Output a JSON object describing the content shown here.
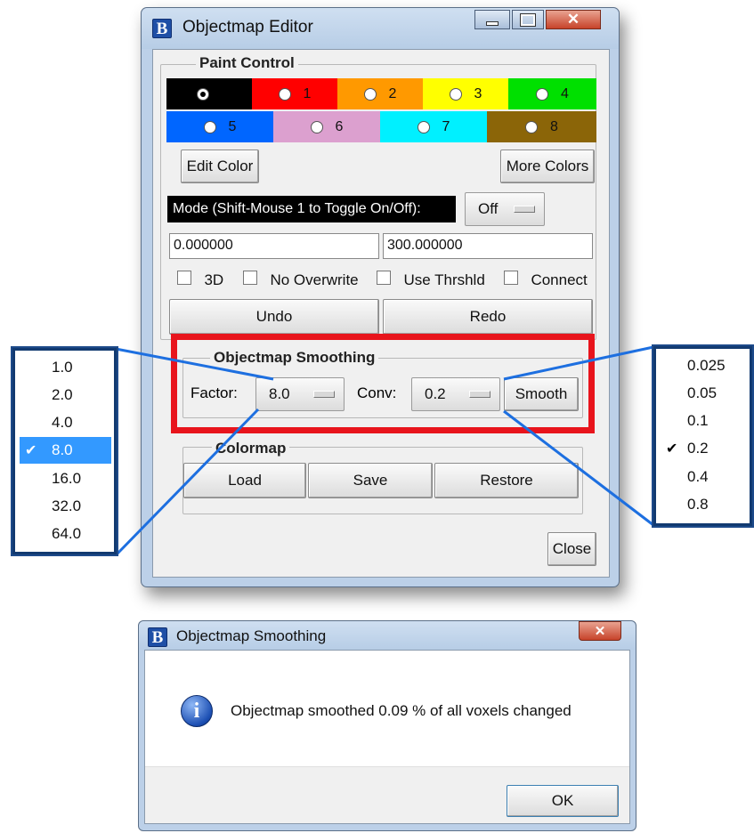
{
  "main_window": {
    "app_icon_letter": "B",
    "title": "Objectmap Editor",
    "paint_control": {
      "title": "Paint Control",
      "colors": [
        {
          "label": "",
          "color": "#000000",
          "selected": true
        },
        {
          "label": "1",
          "color": "#ff0000",
          "selected": false
        },
        {
          "label": "2",
          "color": "#ff9900",
          "selected": false
        },
        {
          "label": "3",
          "color": "#ffff00",
          "selected": false
        },
        {
          "label": "4",
          "color": "#00e000",
          "selected": false
        },
        {
          "label": "5",
          "color": "#0066ff",
          "selected": false
        },
        {
          "label": "6",
          "color": "#dca0cf",
          "selected": false
        },
        {
          "label": "7",
          "color": "#00f0ff",
          "selected": false
        },
        {
          "label": "8",
          "color": "#8b6508",
          "selected": false
        }
      ],
      "edit_color_label": "Edit Color",
      "more_colors_label": "More Colors",
      "mode_label": "Mode (Shift-Mouse 1 to Toggle On/Off):",
      "mode_value": "Off",
      "low_value": "0.000000",
      "high_value": "300.000000",
      "options": [
        {
          "label": "3D",
          "checked": false
        },
        {
          "label": "No Overwrite",
          "checked": false
        },
        {
          "label": "Use Thrshld",
          "checked": false
        },
        {
          "label": "Connect",
          "checked": false
        }
      ],
      "undo_label": "Undo",
      "redo_label": "Redo"
    },
    "smoothing": {
      "title": "Objectmap Smoothing",
      "factor_label": "Factor:",
      "factor_value": "8.0",
      "conv_label": "Conv:",
      "conv_value": "0.2",
      "smooth_label": "Smooth"
    },
    "colormap": {
      "title": "Colormap",
      "load_label": "Load",
      "save_label": "Save",
      "restore_label": "Restore"
    },
    "close_label": "Close"
  },
  "factor_menu": {
    "options": [
      "1.0",
      "2.0",
      "4.0",
      "8.0",
      "16.0",
      "32.0",
      "64.0"
    ],
    "selected": "8.0"
  },
  "conv_menu": {
    "options": [
      "0.025",
      "0.05",
      "0.1",
      "0.2",
      "0.4",
      "0.8"
    ],
    "selected": "0.2"
  },
  "dialog": {
    "app_icon_letter": "B",
    "title": "Objectmap Smoothing",
    "message": "Objectmap smoothed 0.09 % of all voxels changed",
    "info_icon_glyph": "i",
    "ok_label": "OK"
  },
  "colors": {
    "highlight": "#e8141c",
    "callout": "#1d6fe0",
    "menu_selected": "#3399ff"
  }
}
